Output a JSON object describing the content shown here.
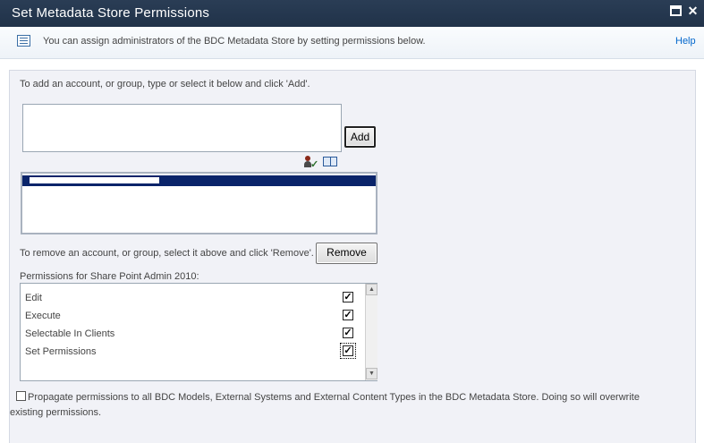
{
  "window": {
    "title": "Set Metadata Store Permissions",
    "close_glyph": "✕"
  },
  "infobar": {
    "icon": "list-icon",
    "text": "You can assign administrators of the BDC Metadata Store by setting permissions below.",
    "help_label": "Help"
  },
  "accounts": {
    "add_instructions": "To add an account, or group, type or select it below and click 'Add'.",
    "input_value": "",
    "add_label": "Add",
    "check_names_icon": "check-names-icon",
    "browse_icon": "address-book-icon",
    "selected_user": "[redacted]",
    "remove_instructions": "To remove an account, or group, select it above and click 'Remove'.",
    "remove_label": "Remove"
  },
  "permissions": {
    "heading": "Permissions for Share Point Admin 2010:",
    "items": [
      {
        "label": "Edit",
        "checked": true
      },
      {
        "label": "Execute",
        "checked": true
      },
      {
        "label": "Selectable In Clients",
        "checked": true
      },
      {
        "label": "Set Permissions",
        "checked": true
      }
    ],
    "check_glyph": "✓",
    "scroll_up_glyph": "▲",
    "scroll_down_glyph": "▼"
  },
  "propagate": {
    "checked": false,
    "text": "Propagate permissions to all BDC Models, External Systems and External Content Types in the BDC Metadata Store. Doing so will overwrite existing permissions."
  },
  "colors": {
    "titlebar": "#203249",
    "selection": "#0a246a",
    "panel_bg": "#f1f2f7",
    "link": "#0066cc"
  }
}
